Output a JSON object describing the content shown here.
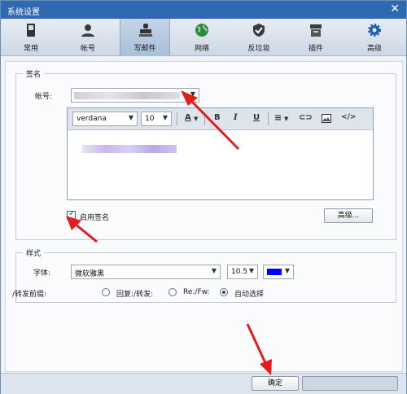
{
  "window": {
    "title": "系统设置",
    "close_icon": "close-icon"
  },
  "toolbar": {
    "items": [
      {
        "label": "常用",
        "icon": "phone-icon"
      },
      {
        "label": "帐号",
        "icon": "user-icon"
      },
      {
        "label": "写邮件",
        "icon": "stamp-icon"
      },
      {
        "label": "网络",
        "icon": "globe-icon"
      },
      {
        "label": "反垃圾",
        "icon": "shield-icon"
      },
      {
        "label": "插件",
        "icon": "plugin-icon"
      },
      {
        "label": "高级",
        "icon": "gear-icon"
      }
    ],
    "active_index": 2
  },
  "signature": {
    "group_title": "签名",
    "account_label": "帐号:",
    "editor": {
      "font": "verdana",
      "size": "10",
      "color_btn": "A",
      "bold": "B",
      "italic": "I",
      "underline": "U"
    },
    "enable_label": "启用签名",
    "enable_checked": true,
    "advanced_button": "高级..."
  },
  "style": {
    "group_title": "样式",
    "font_label": "字体:",
    "font_value": "微软雅黑",
    "size_value": "10.5",
    "color_value": "#0000ff",
    "prefix_label": "/转发前缀:",
    "options": [
      "回复:/转发:",
      "Re:/Fw:",
      "自动选择"
    ],
    "selected_option": 2
  },
  "footer": {
    "ok_button": "确定"
  }
}
